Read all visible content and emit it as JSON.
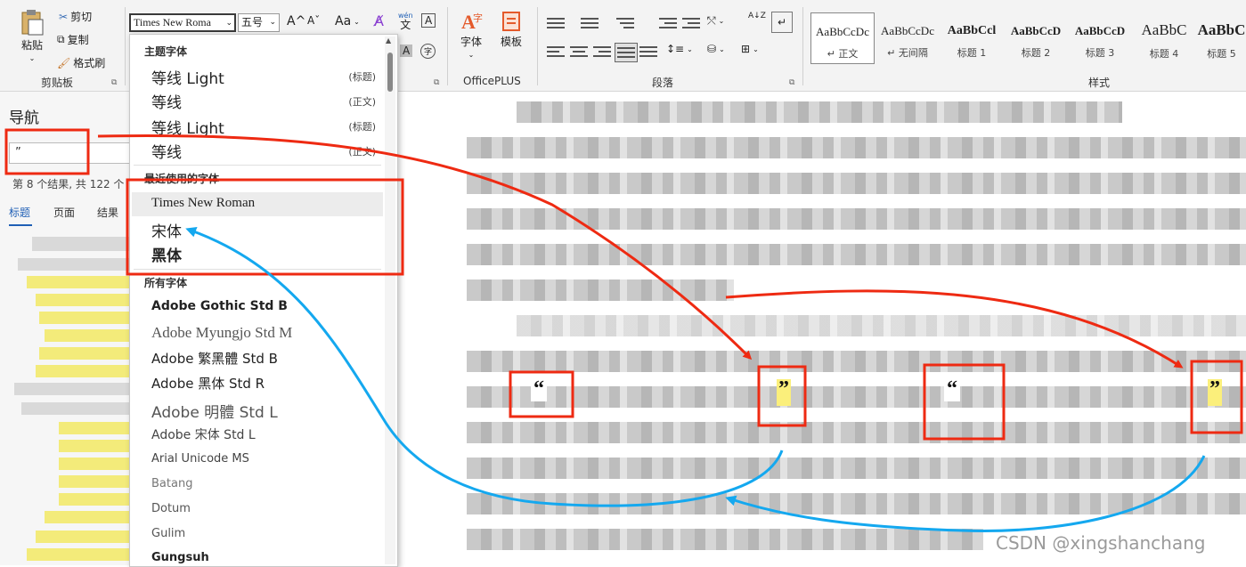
{
  "ribbon": {
    "clipboard": {
      "paste": "粘贴",
      "cut": "剪切",
      "copy": "复制",
      "format_painter": "格式刷",
      "group": "剪贴板"
    },
    "font": {
      "name_value": "Times New Roma",
      "size_value": "五号",
      "grow": "A^",
      "shrink": "Aˇ",
      "case": "Aa",
      "pinyin_top": "wén",
      "pinyin_bottom": "文",
      "char_border": "A",
      "highlight_a": "A",
      "enclose": "字"
    },
    "officeplus": {
      "font": "字体",
      "template": "模板",
      "group": "OfficePLUS"
    },
    "paragraph": {
      "group": "段落",
      "sort": "A↓Z"
    },
    "styles": {
      "group": "样式",
      "items": [
        {
          "sample": "AaBbCcDc",
          "name": "↵ 正文"
        },
        {
          "sample": "AaBbCcDc",
          "name": "↵ 无间隔"
        },
        {
          "sample": "AaBbCcl",
          "name": "标题 1"
        },
        {
          "sample": "AaBbCcD",
          "name": "标题 2"
        },
        {
          "sample": "AaBbCcD",
          "name": "标题 3"
        },
        {
          "sample": "AaBbC",
          "name": "标题 4"
        },
        {
          "sample": "AaBbC",
          "name": "标题 5"
        }
      ]
    }
  },
  "nav": {
    "title": "导航",
    "search_value": "”",
    "result_text": "第 8 个结果, 共 122 个",
    "tabs": [
      "标题",
      "页面",
      "结果"
    ]
  },
  "dropdown": {
    "theme_header": "主题字体",
    "theme_fonts": [
      {
        "name": "等线 Light",
        "tag": "(标题)"
      },
      {
        "name": "等线",
        "tag": "(正文)"
      },
      {
        "name": "等线 Light",
        "tag": "(标题)"
      },
      {
        "name": "等线",
        "tag": "(正文)"
      }
    ],
    "recent_header": "最近使用的字体",
    "recent_fonts": [
      "Times New Roman",
      "宋体",
      "黑体"
    ],
    "all_header": "所有字体",
    "all_fonts": [
      "Adobe Gothic Std B",
      "Adobe Myungjo Std M",
      "Adobe 繁黑體 Std B",
      "Adobe 黑体 Std R",
      "Adobe 明體 Std L",
      "Adobe 宋体 Std L",
      "Arial Unicode MS",
      "Batang",
      "Dotum",
      "Gulim",
      "Gungsuh"
    ]
  },
  "document": {
    "quotes": [
      "“",
      "”",
      "“",
      "”"
    ]
  },
  "watermark": "CSDN @xingshanchang",
  "colors": {
    "annotation_red": "#ee2a12",
    "annotation_blue": "#14a8ef",
    "highlight_yellow": "#fbef7b",
    "accent_blue": "#1f5fb5"
  }
}
